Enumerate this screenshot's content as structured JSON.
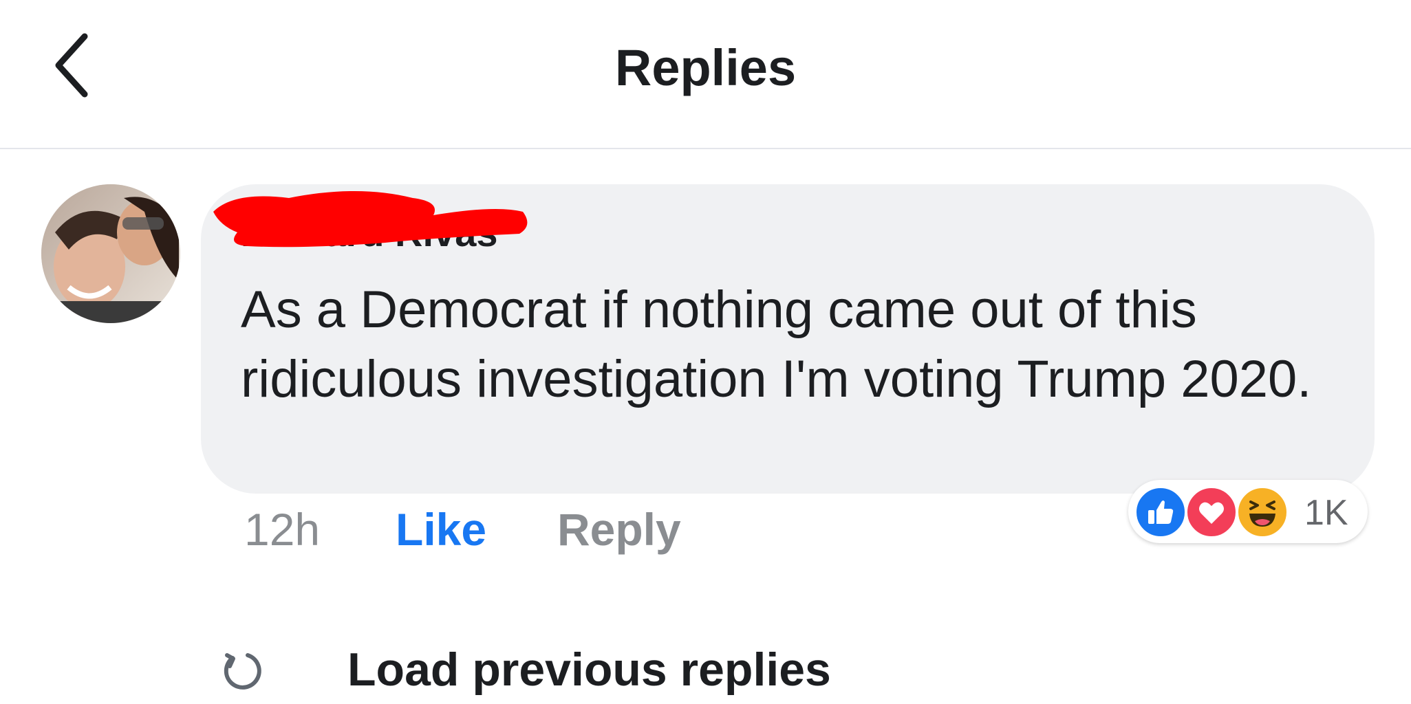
{
  "header": {
    "title": "Replies",
    "back_icon": "chevron-left-icon"
  },
  "comment": {
    "author": "Richard Rivas",
    "text": "As a Democrat if nothing came out of this ridiculous investigation I'm voting Trump 2020.",
    "timestamp": "12h",
    "like_label": "Like",
    "reply_label": "Reply",
    "reactions": {
      "icons": [
        "like-reaction-icon",
        "love-reaction-icon",
        "haha-reaction-icon"
      ],
      "count": "1K"
    }
  },
  "load_previous": {
    "label": "Load previous replies",
    "icon": "refresh-icon"
  },
  "colors": {
    "like_blue": "#1877f2",
    "love_red": "#f33e58",
    "haha_yellow": "#f7b125",
    "bubble_bg": "#f0f1f3",
    "redaction_red": "#ff0000"
  }
}
